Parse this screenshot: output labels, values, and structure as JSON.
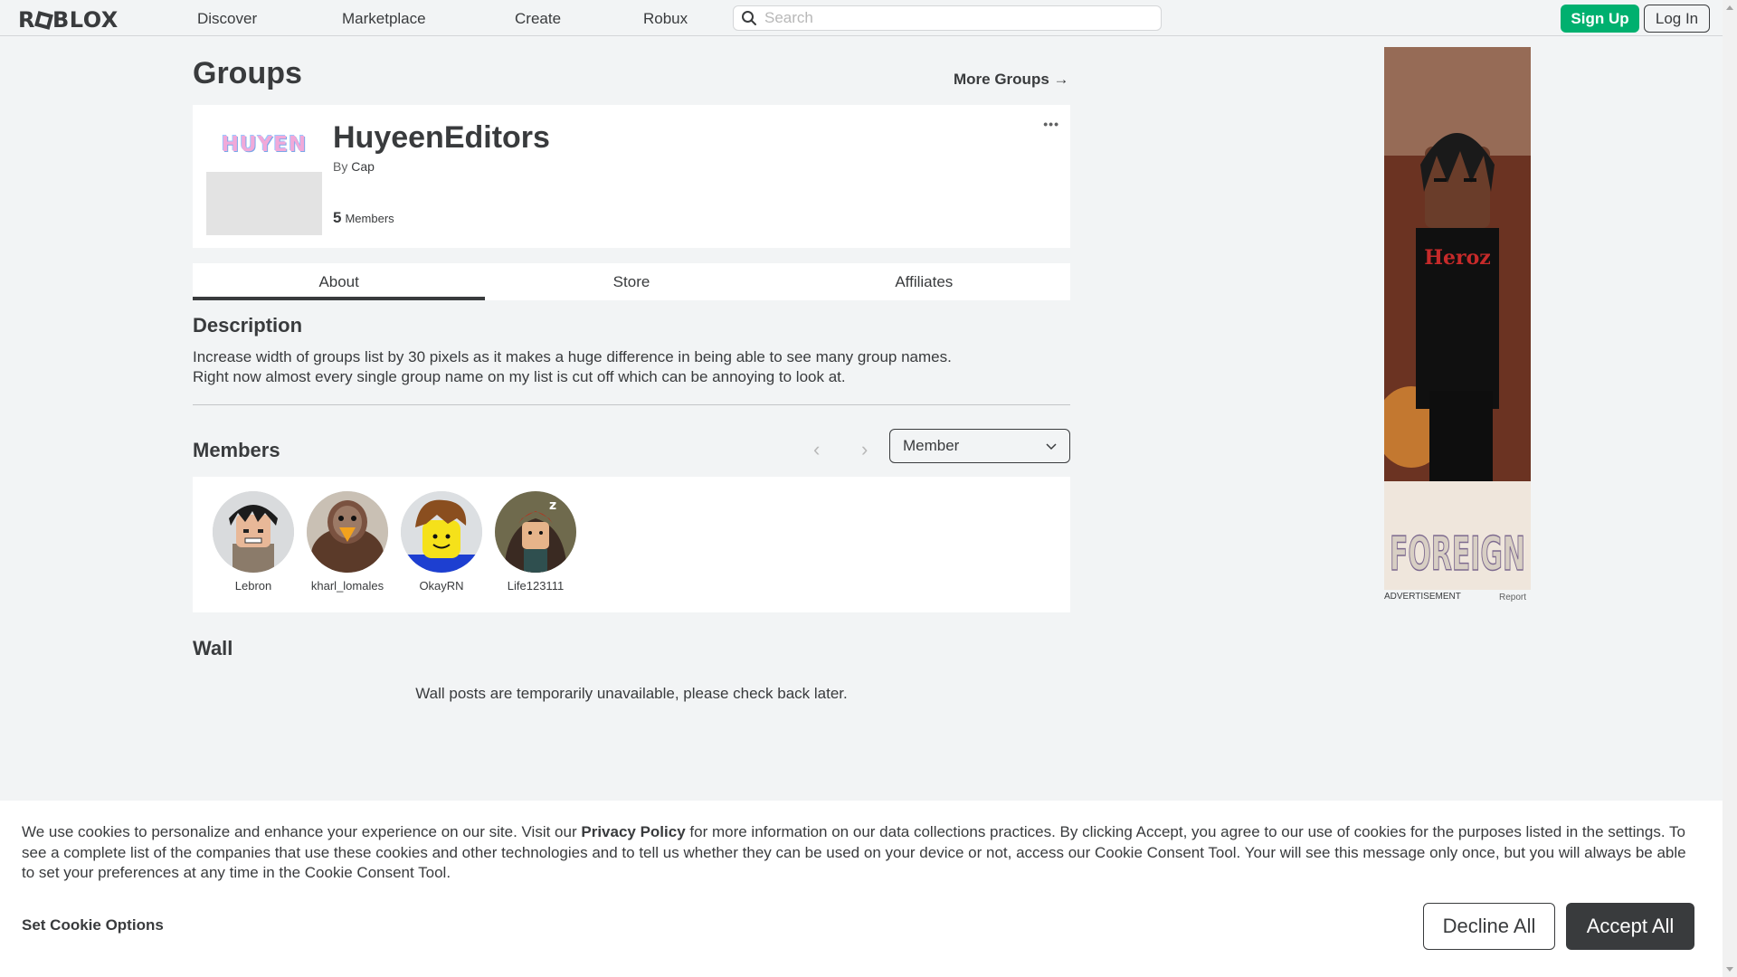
{
  "brand": {
    "logo_text_a": "R",
    "logo_text_b": "BLOX"
  },
  "nav": {
    "links": [
      "Discover",
      "Marketplace",
      "Create",
      "Robux"
    ],
    "search_placeholder": "Search",
    "signup_label": "Sign Up",
    "login_label": "Log In"
  },
  "page": {
    "title": "Groups",
    "more_groups": "More Groups →"
  },
  "group": {
    "name": "HuyeenEditors",
    "emblem_text": "HUYEN",
    "by_label": "By",
    "owner": "Cap",
    "member_count": "5",
    "members_label": "Members",
    "menu_icon": "•••"
  },
  "tabs": [
    {
      "label": "About",
      "active": true
    },
    {
      "label": "Store",
      "active": false
    },
    {
      "label": "Affiliates",
      "active": false
    }
  ],
  "description": {
    "heading": "Description",
    "line1": "Increase width of groups list by 30 pixels as it makes a huge difference in being able to see many group names.",
    "line2": "Right now almost every single group name on my list is cut off which can be annoying to look at."
  },
  "members": {
    "heading": "Members",
    "role_filter": "Member",
    "prev_icon": "‹",
    "next_icon": "›",
    "list": [
      {
        "name": "Lebron"
      },
      {
        "name": "kharl_lomales"
      },
      {
        "name": "OkayRN"
      },
      {
        "name": "Life123111"
      }
    ]
  },
  "wall": {
    "heading": "Wall",
    "message": "Wall posts are temporarily unavailable, please check back later."
  },
  "ad": {
    "label": "ADVERTISEMENT",
    "report": "Report",
    "art_text": "FOREIGN",
    "shirt_text": "Heroz"
  },
  "cookie": {
    "text_before": "We use cookies to personalize and enhance your experience on our site. Visit our ",
    "privacy_link": "Privacy Policy",
    "text_after": " for more information on our data collections practices. By clicking Accept, you agree to our use of cookies for the purposes listed in the settings. To see a complete list of the companies that use these cookies and other technologies and to tell us whether they can be used on your device or not, access our Cookie Consent Tool. Your will see this message only once, but you will always be able to set your preferences at any time in the Cookie Consent Tool.",
    "set_options": "Set Cookie Options",
    "decline": "Decline All",
    "accept": "Accept All"
  },
  "colors": {
    "background": "#f2f4f5",
    "text": "#393b3d",
    "signup_green": "#00b06f",
    "accept_dark": "#393b3d"
  }
}
